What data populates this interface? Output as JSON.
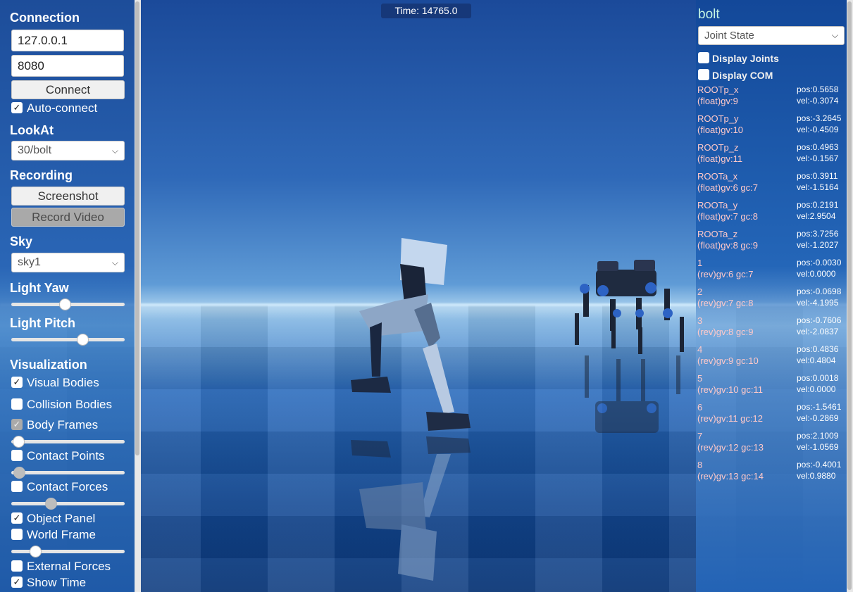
{
  "viewport": {
    "time_label": "Time: 14765.0"
  },
  "left_panel": {
    "connection": {
      "title": "Connection",
      "ip_value": "127.0.0.1",
      "port_value": "8080",
      "connect_label": "Connect",
      "auto_connect_label": "Auto-connect",
      "auto_connect_checked": true
    },
    "lookat": {
      "title": "LookAt",
      "selected": "30/bolt"
    },
    "recording": {
      "title": "Recording",
      "screenshot_label": "Screenshot",
      "record_video_label": "Record Video"
    },
    "sky": {
      "title": "Sky",
      "selected": "sky1"
    },
    "light_yaw": {
      "title": "Light Yaw",
      "value_fraction": 0.47
    },
    "light_pitch": {
      "title": "Light Pitch",
      "value_fraction": 0.63
    },
    "visualization": {
      "title": "Visualization",
      "items": [
        {
          "label": "Visual Bodies",
          "checked": true
        },
        {
          "label": "Collision Bodies",
          "checked": false
        },
        {
          "label": "Body Frames",
          "checked": true,
          "slider_fraction": 0.06
        },
        {
          "label": "Contact Points",
          "checked": false,
          "slider_fraction": 0.07
        },
        {
          "label": "Contact Forces",
          "checked": false,
          "slider_fraction": 0.35
        },
        {
          "label": "Object Panel",
          "checked": true
        },
        {
          "label": "World Frame",
          "checked": false,
          "slider_fraction": 0.21
        },
        {
          "label": "External Forces",
          "checked": false
        },
        {
          "label": "Show Time",
          "checked": true
        }
      ]
    }
  },
  "right_panel": {
    "object_name": "bolt",
    "view_select": "Joint State",
    "display_joints_label": "Display Joints",
    "display_com_label": "Display COM",
    "joints": [
      {
        "name": "ROOTp_x",
        "gv": "(float)gv:9",
        "pos": "pos:0.5658",
        "vel": "vel:-0.3074"
      },
      {
        "name": "ROOTp_y",
        "gv": "(float)gv:10",
        "pos": "pos:-3.2645",
        "vel": "vel:-0.4509"
      },
      {
        "name": "ROOTp_z",
        "gv": "(float)gv:11",
        "pos": "pos:0.4963",
        "vel": "vel:-0.1567"
      },
      {
        "name": "ROOTa_x",
        "gv": "(float)gv:6 gc:7",
        "pos": "pos:0.3911",
        "vel": "vel:-1.5164"
      },
      {
        "name": "ROOTa_y",
        "gv": "(float)gv:7 gc:8",
        "pos": "pos:0.2191",
        "vel": "vel:2.9504"
      },
      {
        "name": "ROOTa_z",
        "gv": "(float)gv:8 gc:9",
        "pos": "pos:3.7256",
        "vel": "vel:-1.2027"
      },
      {
        "name": "1",
        "gv": "(rev)gv:6 gc:7",
        "pos": "pos:-0.0030",
        "vel": "vel:0.0000"
      },
      {
        "name": "2",
        "gv": "(rev)gv:7 gc:8",
        "pos": "pos:-0.0698",
        "vel": "vel:-4.1995"
      },
      {
        "name": "3",
        "gv": "(rev)gv:8 gc:9",
        "pos": "pos:-0.7606",
        "vel": "vel:-2.0837"
      },
      {
        "name": "4",
        "gv": "(rev)gv:9 gc:10",
        "pos": "pos:0.4836",
        "vel": "vel:0.4804"
      },
      {
        "name": "5",
        "gv": "(rev)gv:10 gc:11",
        "pos": "pos:0.0018",
        "vel": "vel:0.0000"
      },
      {
        "name": "6",
        "gv": "(rev)gv:11 gc:12",
        "pos": "pos:-1.5461",
        "vel": "vel:-0.2869"
      },
      {
        "name": "7",
        "gv": "(rev)gv:12 gc:13",
        "pos": "pos:2.1009",
        "vel": "vel:-1.0569"
      },
      {
        "name": "8",
        "gv": "(rev)gv:13 gc:14",
        "pos": "pos:-0.4001",
        "vel": "vel:0.9880"
      }
    ]
  }
}
